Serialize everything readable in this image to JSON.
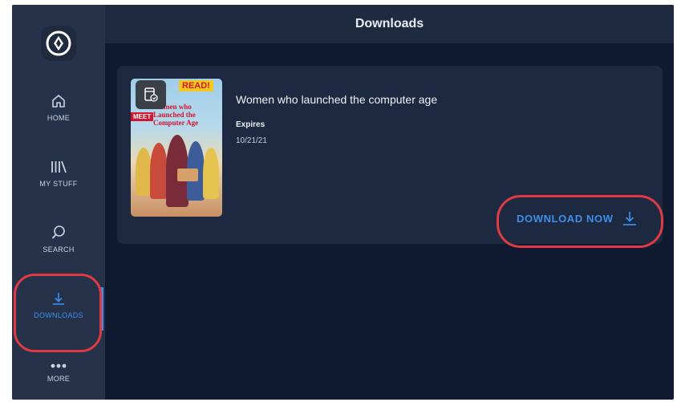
{
  "header": {
    "title": "Downloads"
  },
  "sidebar": {
    "items": [
      {
        "label": "HOME",
        "icon": "home-icon"
      },
      {
        "label": "MY STUFF",
        "icon": "library-icon"
      },
      {
        "label": "SEARCH",
        "icon": "search-icon"
      },
      {
        "label": "DOWNLOADS",
        "icon": "download-icon",
        "active": true
      },
      {
        "label": "MORE",
        "icon": "more-icon"
      }
    ]
  },
  "book": {
    "title": "Women who launched the computer age",
    "expires_label": "Expires",
    "expires_value": "10/21/21",
    "cover_tag": "READ!",
    "cover_meet": "MEET",
    "cover_title": "Women who Launched the Computer Age"
  },
  "actions": {
    "download_now": "DOWNLOAD NOW"
  },
  "colors": {
    "accent": "#3d8fe8",
    "highlight": "#e03a44",
    "background": "#0f1a30",
    "sidebar": "#25324a"
  }
}
